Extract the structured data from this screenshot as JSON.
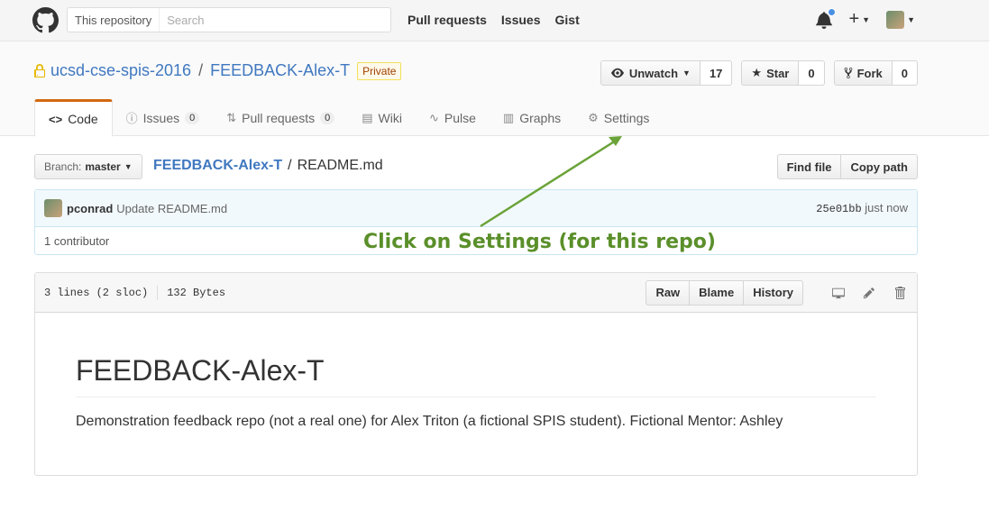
{
  "header": {
    "search_scope": "This repository",
    "search_placeholder": "Search",
    "nav": [
      "Pull requests",
      "Issues",
      "Gist"
    ]
  },
  "repo": {
    "owner": "ucsd-cse-spis-2016",
    "name": "FEEDBACK-Alex-T",
    "visibility": "Private",
    "watch_label": "Unwatch",
    "watch_count": "17",
    "star_label": "Star",
    "star_count": "0",
    "fork_label": "Fork",
    "fork_count": "0"
  },
  "tabs": [
    {
      "label": "Code",
      "icon": "code-icon"
    },
    {
      "label": "Issues",
      "count": "0",
      "icon": "issue-icon"
    },
    {
      "label": "Pull requests",
      "count": "0",
      "icon": "pull-request-icon"
    },
    {
      "label": "Wiki",
      "icon": "book-icon"
    },
    {
      "label": "Pulse",
      "icon": "pulse-icon"
    },
    {
      "label": "Graphs",
      "icon": "graph-icon"
    },
    {
      "label": "Settings",
      "icon": "gear-icon"
    }
  ],
  "file_nav": {
    "branch_prefix": "Branch:",
    "branch": "master",
    "repo_link": "FEEDBACK-Alex-T",
    "separator": "/",
    "filename": "README.md",
    "find_file": "Find file",
    "copy_path": "Copy path"
  },
  "commit": {
    "author": "pconrad",
    "message": "Update README.md",
    "sha": "25e01bb",
    "time": "just now",
    "contributors": "1 contributor"
  },
  "annotation": "Click on Settings (for this repo)",
  "file": {
    "lines": "3 lines (2 sloc)",
    "size": "132 Bytes",
    "raw": "Raw",
    "blame": "Blame",
    "history": "History"
  },
  "readme": {
    "heading": "FEEDBACK-Alex-T",
    "body": "Demonstration feedback repo (not a real one) for Alex Triton (a fictional SPIS student). Fictional Mentor: Ashley"
  },
  "colors": {
    "link": "#4078c0",
    "annotation": "#5a8f2a",
    "tab_accent": "#d26911"
  }
}
